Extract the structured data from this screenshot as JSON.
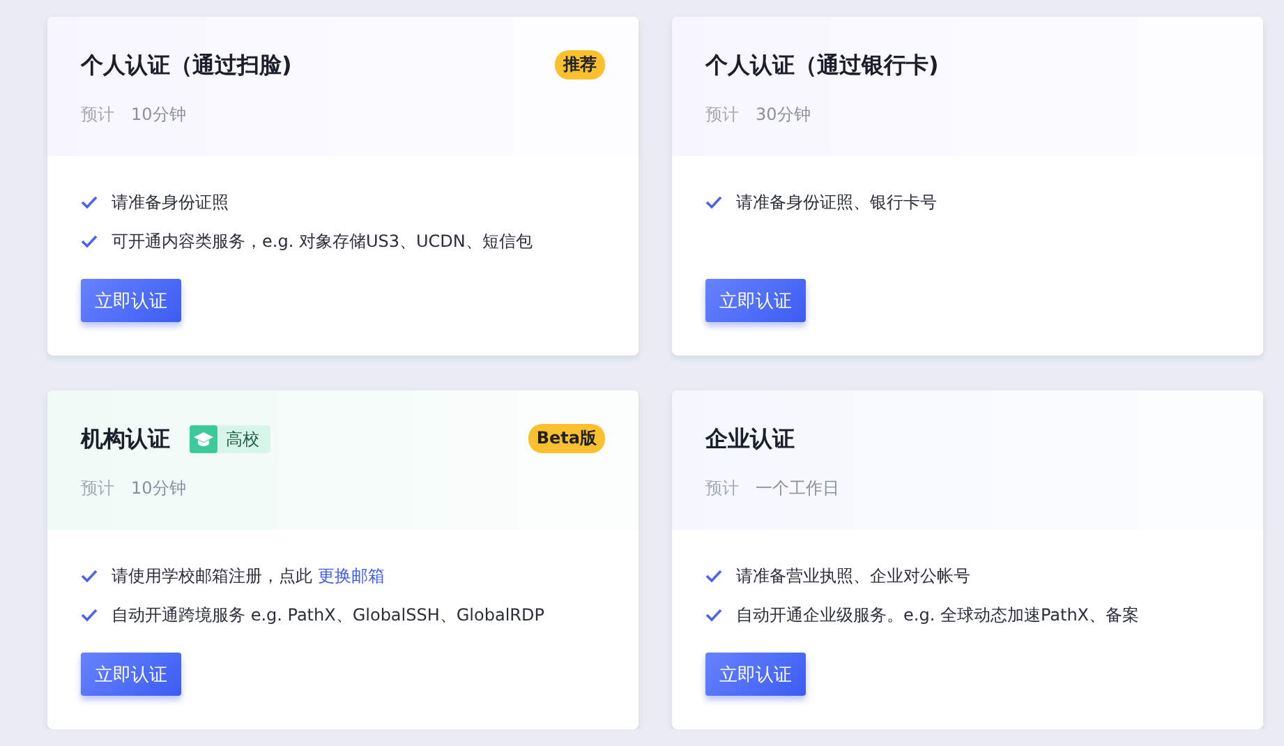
{
  "cards": [
    {
      "title": "个人认证（通过扫脸)",
      "color": "#f7f6ff",
      "badge": "推荐",
      "estimate_label": "预计",
      "estimate": "10分钟",
      "items": [
        {
          "text": "请准备身份证照"
        },
        {
          "text": "可开通内容类服务，e.g. 对象存储US3、UCDN、短信包"
        }
      ],
      "button": "立即认证"
    },
    {
      "title": "个人认证（通过银行卡)",
      "color": "#f7f6ff",
      "estimate_label": "预计",
      "estimate": "30分钟",
      "items": [
        {
          "text": "请准备身份证照、银行卡号"
        }
      ],
      "button": "立即认证"
    },
    {
      "title": "机构认证",
      "color": "#effaf7",
      "tag": "高校",
      "badge": "Beta版",
      "estimate_label": "预计",
      "estimate": "10分钟",
      "items": [
        {
          "text": "请使用学校邮箱注册，点此",
          "link": "更换邮箱"
        },
        {
          "text": "自动开通跨境服务 e.g. PathX、GlobalSSH、GlobalRDP"
        }
      ],
      "button": "立即认证"
    },
    {
      "title": "企业认证",
      "color": "#f4f7fe",
      "estimate_label": "预计",
      "estimate": "一个工作日",
      "items": [
        {
          "text": "请准备营业执照、企业对公帐号"
        },
        {
          "text": "自动开通企业级服务。e.g. 全球动态加速PathX、备案"
        }
      ],
      "button": "立即认证"
    }
  ]
}
